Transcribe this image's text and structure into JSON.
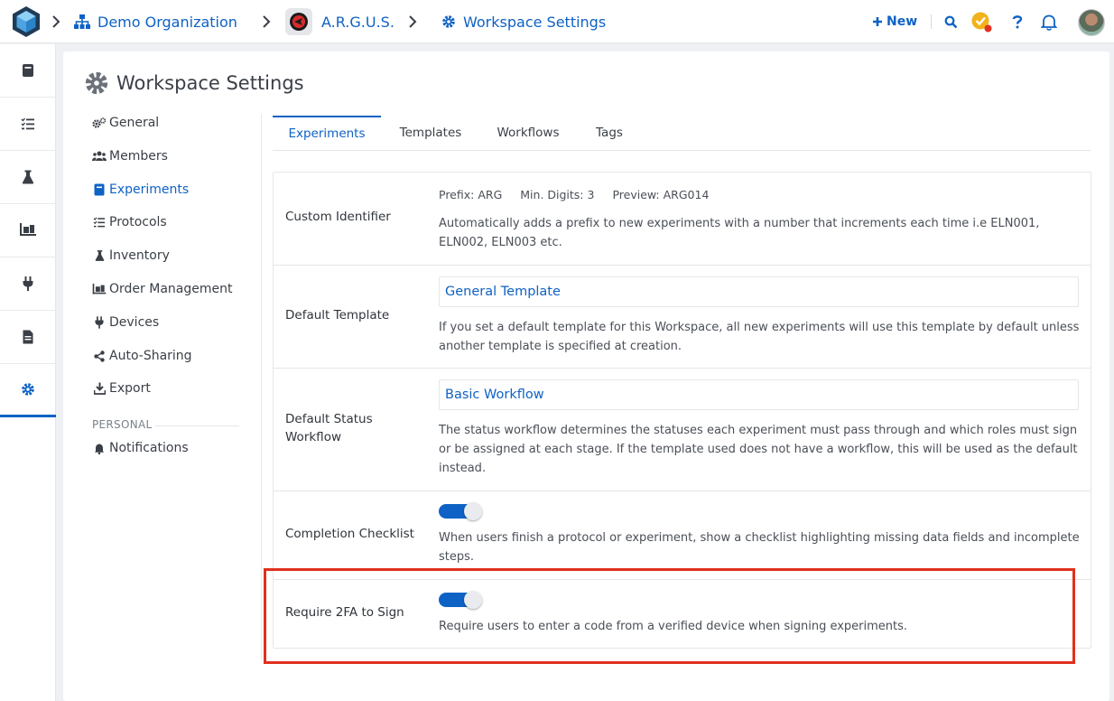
{
  "breadcrumb": {
    "organization": "Demo Organization",
    "project": "A.R.G.U.S.",
    "page": "Workspace Settings"
  },
  "header": {
    "new_label": "New",
    "icons": [
      "plus-icon",
      "search-icon",
      "check-badge-icon",
      "help-icon",
      "bell-icon"
    ],
    "notification_dot_color": "#e0301e"
  },
  "leftnav": {
    "items": [
      "notebook-icon",
      "checklist-icon",
      "flask-icon",
      "pallet-icon",
      "plug-icon",
      "document-icon",
      "settings-icon"
    ],
    "active": "settings-icon"
  },
  "page_title": "Workspace Settings",
  "settings_menu": {
    "items": [
      {
        "label": "General",
        "icon": "gears-icon"
      },
      {
        "label": "Members",
        "icon": "users-icon"
      },
      {
        "label": "Experiments",
        "icon": "book-icon"
      },
      {
        "label": "Protocols",
        "icon": "checklist-icon"
      },
      {
        "label": "Inventory",
        "icon": "flask-icon"
      },
      {
        "label": "Order Management",
        "icon": "pallet-icon"
      },
      {
        "label": "Devices",
        "icon": "plug-icon"
      },
      {
        "label": "Auto-Sharing",
        "icon": "share-icon"
      },
      {
        "label": "Export",
        "icon": "download-icon"
      }
    ],
    "active": "Experiments",
    "section_label": "PERSONAL",
    "personal_items": [
      {
        "label": "Notifications",
        "icon": "bell-icon"
      }
    ]
  },
  "tabs": [
    {
      "label": "Experiments",
      "active": true
    },
    {
      "label": "Templates",
      "active": false
    },
    {
      "label": "Workflows",
      "active": false
    },
    {
      "label": "Tags",
      "active": false
    }
  ],
  "settings": {
    "custom_identifier": {
      "label": "Custom Identifier",
      "prefix": "Prefix: ARG",
      "min_digits": "Min. Digits: 3",
      "preview": "Preview: ARG014",
      "description": "Automatically adds a prefix to new experiments with a number that increments each time i.e ELN001, ELN002, ELN003 etc."
    },
    "default_template": {
      "label": "Default Template",
      "value": "General Template",
      "description": "If you set a default template for this Workspace, all new experiments will use this template by default unless another template is specified at creation."
    },
    "default_status_workflow": {
      "label": "Default Status Workflow",
      "value": "Basic Workflow",
      "description": "The status workflow determines the statuses each experiment must pass through and which roles must sign or be assigned at each stage. If the template used does not have a workflow, this will be used as the default instead."
    },
    "completion_checklist": {
      "label": "Completion Checklist",
      "enabled": true,
      "description": "When users finish a protocol or experiment, show a checklist highlighting missing data fields and incomplete steps."
    },
    "require_2fa": {
      "label": "Require 2FA to Sign",
      "enabled": true,
      "description": "Require users to enter a code from a verified device when signing experiments."
    }
  },
  "colors": {
    "accent": "#0e62c5",
    "highlight_border": "#e0301e",
    "toggle_on": "#0e62c5"
  }
}
